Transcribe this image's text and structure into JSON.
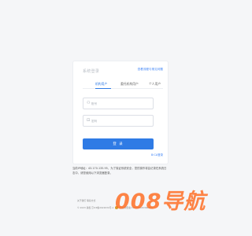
{
  "login": {
    "title": "系统登录",
    "help_link": "查看流程与常见问题",
    "tabs": [
      {
        "label": "机构用户"
      },
      {
        "label": "委托机构用户"
      },
      {
        "label": "个人用户"
      }
    ],
    "username_placeholder": "账号",
    "password_placeholder": "密码",
    "submit_label": "登 录",
    "ca_link": "CA登录"
  },
  "notice": "当前IP地址：43.170.135.95，为了保证系统安全，您的操作将会记录在系统日志中，请您使用以下浏览器登录。",
  "footer": {
    "line1": "关于我们   联系方式",
    "line2_left": "© 2023 版权   京ICP备2022034号-1",
    "line2_right": "京公网安备 11010802039693号"
  },
  "watermark_text": "008导航",
  "colors": {
    "primary": "#2f7be5",
    "watermark": "#ff6a1f",
    "background": "#f5f6f8"
  }
}
